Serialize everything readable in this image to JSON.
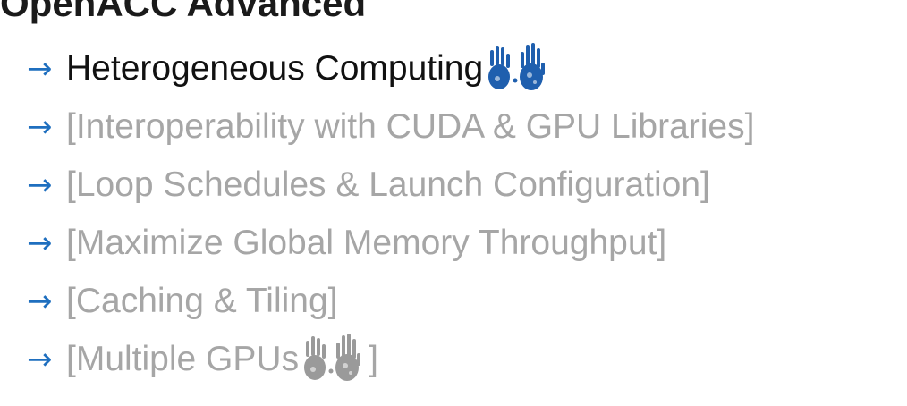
{
  "slide": {
    "title": "OpenACC Advanced",
    "items": [
      {
        "label": "Heterogeneous Computing",
        "state": "active",
        "icon": "hand-prints-icon"
      },
      {
        "label": "[Interoperability with CUDA & GPU Libraries]",
        "state": "inactive"
      },
      {
        "label": "[Loop Schedules & Launch Configuration]",
        "state": "inactive"
      },
      {
        "label": "[Maximize Global Memory Throughput]",
        "state": "inactive"
      },
      {
        "label": "[Caching & Tiling]",
        "state": "inactive"
      },
      {
        "label_prefix": "[Multiple GPUs",
        "label_suffix": "]",
        "state": "inactive",
        "icon": "hand-prints-icon"
      }
    ],
    "arrow_glyph": "→"
  },
  "colors": {
    "arrow": "#1f6fbf",
    "active_text": "#111111",
    "inactive_text": "#a6a6a6",
    "hand_active": "#1f5fae",
    "hand_inactive": "#9a9a9a"
  }
}
